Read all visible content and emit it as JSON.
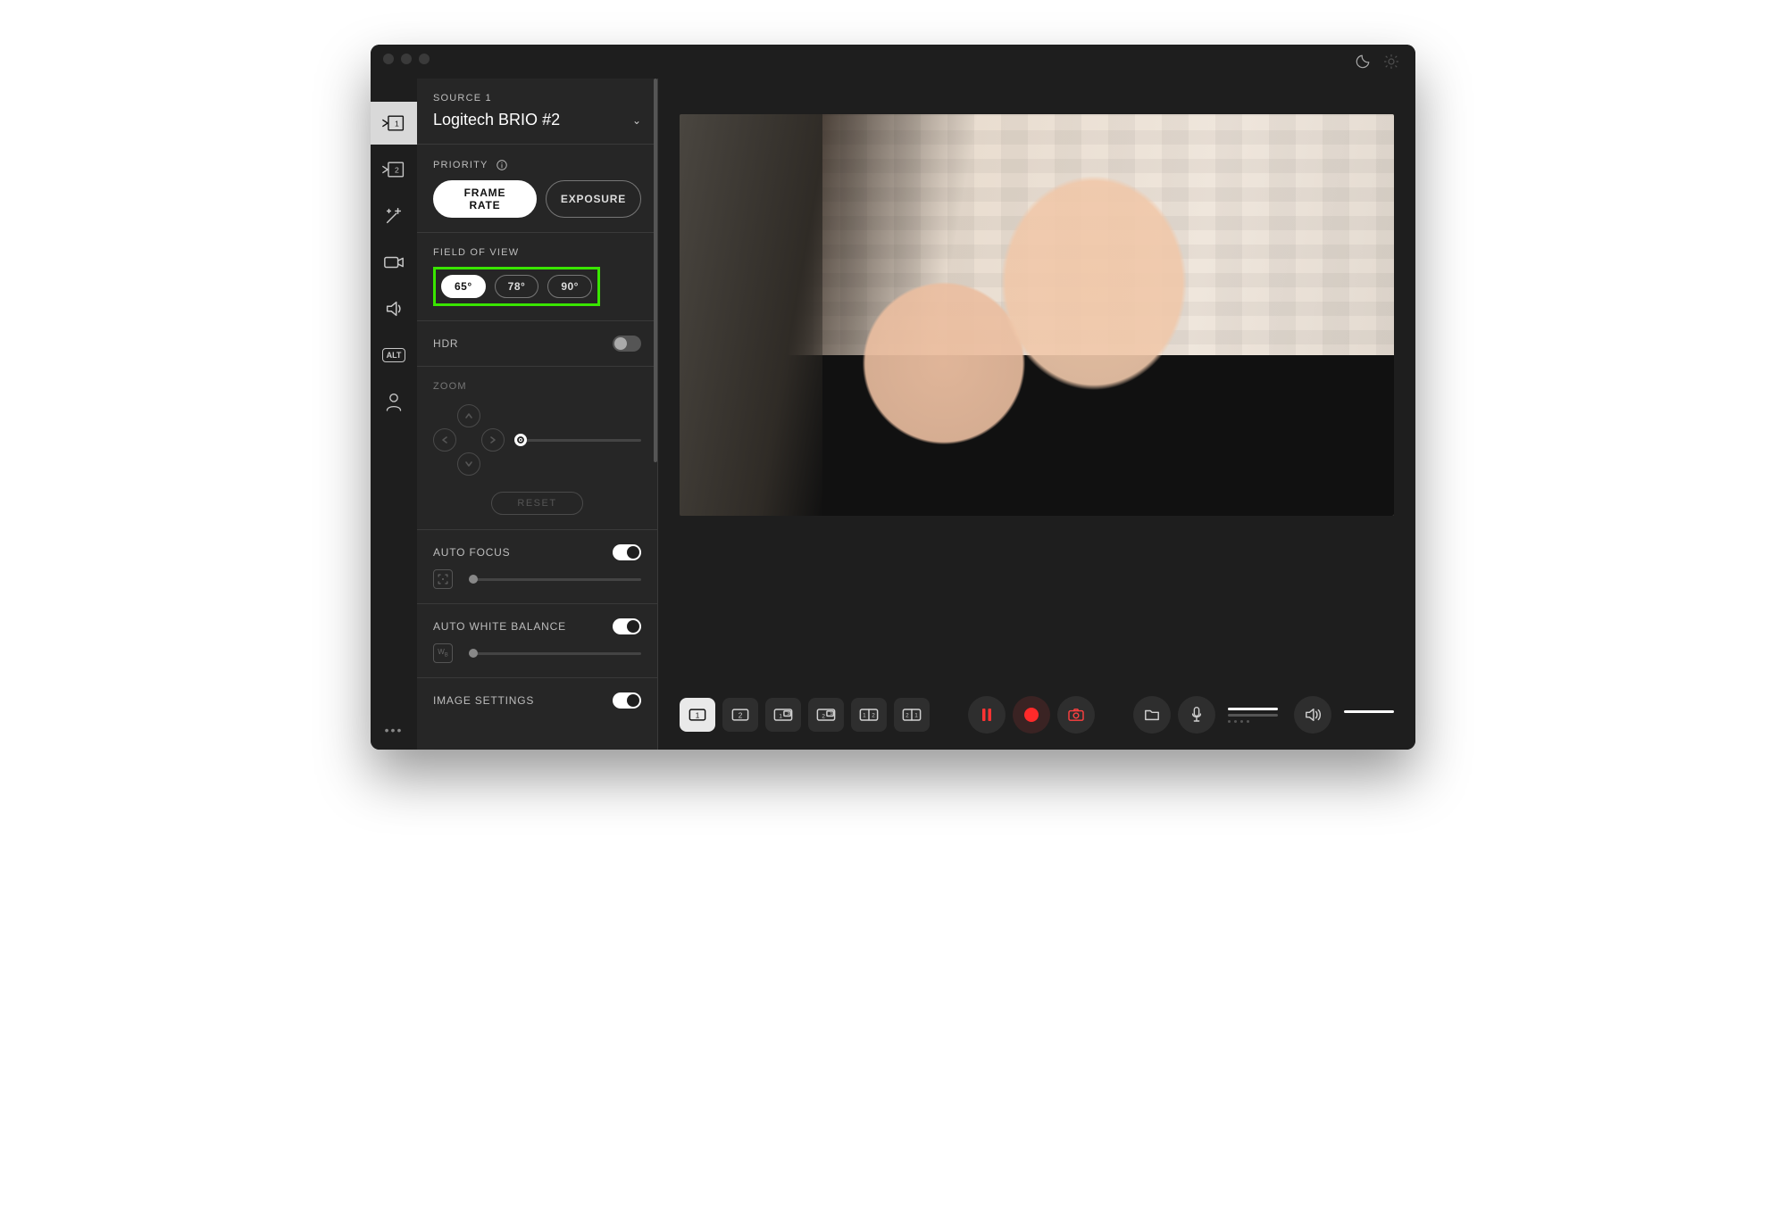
{
  "source": {
    "label": "SOURCE 1",
    "device": "Logitech BRIO #2"
  },
  "priority": {
    "label": "PRIORITY",
    "options": [
      "FRAME RATE",
      "EXPOSURE"
    ],
    "selected": "FRAME RATE"
  },
  "fov": {
    "label": "FIELD OF VIEW",
    "options": [
      "65°",
      "78°",
      "90°"
    ],
    "selected": "65°"
  },
  "hdr": {
    "label": "HDR",
    "on": false
  },
  "zoom": {
    "label": "ZOOM",
    "reset": "RESET"
  },
  "autofocus": {
    "label": "AUTO FOCUS",
    "on": true
  },
  "awb": {
    "label": "AUTO WHITE BALANCE",
    "on": true
  },
  "image_settings": {
    "label": "IMAGE SETTINGS",
    "on": true
  },
  "bottom": {
    "layouts": [
      "1",
      "2",
      "12",
      "21",
      "12",
      "21"
    ]
  }
}
